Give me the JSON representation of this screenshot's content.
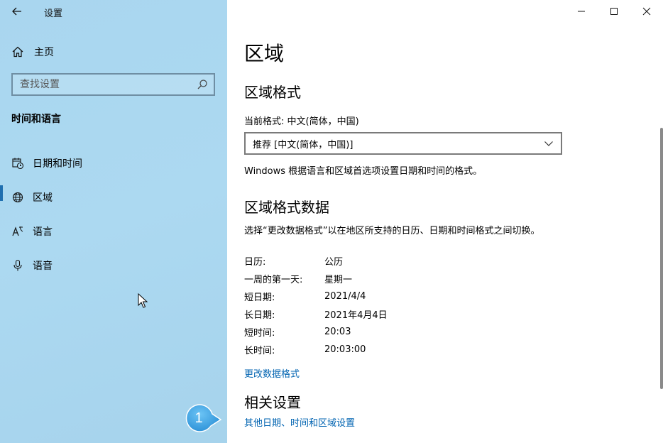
{
  "window": {
    "title": "设置"
  },
  "sidebar": {
    "home_label": "主页",
    "search_placeholder": "查找设置",
    "section_title": "时间和语言",
    "items": [
      {
        "label": "日期和时间",
        "icon": "calendar-clock-icon"
      },
      {
        "label": "区域",
        "icon": "globe-icon",
        "active": true
      },
      {
        "label": "语言",
        "icon": "language-icon"
      },
      {
        "label": "语音",
        "icon": "microphone-icon"
      }
    ]
  },
  "main": {
    "title": "区域",
    "region_format": {
      "heading": "区域格式",
      "current_label": "当前格式: 中文(简体，中国)",
      "dropdown_value": "推荐 [中文(简体，中国)]",
      "description": "Windows 根据语言和区域首选项设置日期和时间的格式。"
    },
    "format_data": {
      "heading": "区域格式数据",
      "description": "选择“更改数据格式”以在地区所支持的日历、日期和时间格式之间切换。",
      "rows": [
        {
          "key": "日历:",
          "value": "公历"
        },
        {
          "key": "一周的第一天:",
          "value": "星期一"
        },
        {
          "key": "短日期:",
          "value": "2021/4/4"
        },
        {
          "key": "长日期:",
          "value": "2021年4月4日"
        },
        {
          "key": "短时间:",
          "value": "20:03"
        },
        {
          "key": "长时间:",
          "value": "20:03:00"
        }
      ],
      "change_link": "更改数据格式"
    },
    "related": {
      "heading": "相关设置",
      "link": "其他日期、时间和区域设置"
    }
  },
  "annotation": {
    "step_number": "1",
    "color": "#3aa0e0"
  },
  "colors": {
    "accent": "#0063b1",
    "sidebar_bg": "#acd9f1"
  }
}
